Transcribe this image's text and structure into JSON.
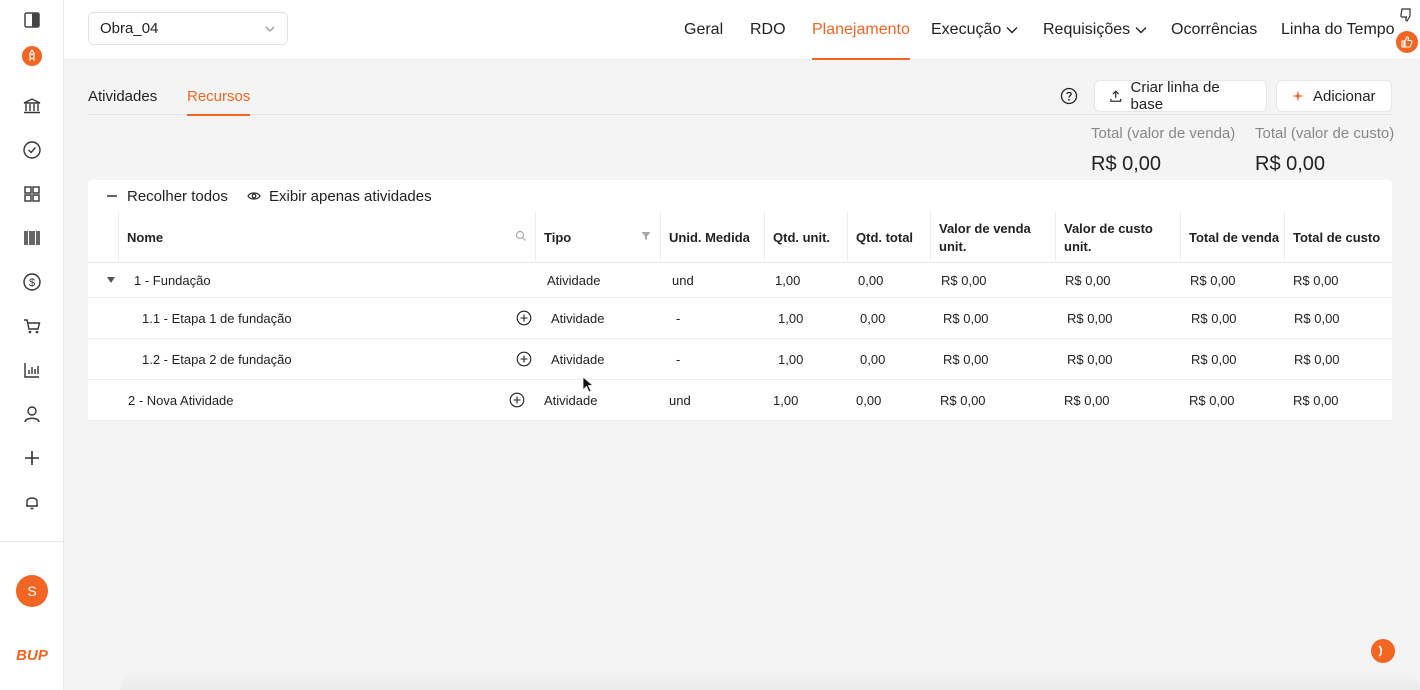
{
  "project": {
    "name": "Obra_04"
  },
  "nav": {
    "items": [
      {
        "label": "Geral"
      },
      {
        "label": "RDO"
      },
      {
        "label": "Planejamento"
      },
      {
        "label": "Execução"
      },
      {
        "label": "Requisições"
      },
      {
        "label": "Ocorrências"
      },
      {
        "label": "Linha do Tempo"
      }
    ]
  },
  "sidebar": {
    "icons": [
      "panel-toggle-icon",
      "rocket-icon",
      "bank-icon",
      "check-circle-icon",
      "grid-icon",
      "barcode-icon",
      "dollar-icon",
      "cart-icon",
      "bar-chart-icon",
      "user-icon",
      "plus-icon",
      "bell-icon"
    ],
    "avatar_initial": "S",
    "logo": "BUP"
  },
  "tabs": [
    {
      "label": "Atividades"
    },
    {
      "label": "Recursos"
    }
  ],
  "actions": {
    "baseline_label": "Criar linha de base",
    "add_label": "Adicionar"
  },
  "totals": {
    "sale_label": "Total (valor de venda)",
    "sale_value": "R$ 0,00",
    "cost_label": "Total (valor de custo)",
    "cost_value": "R$ 0,00"
  },
  "table_tools": {
    "collapse_label": "Recolher todos",
    "show_only_label": "Exibir apenas atividades"
  },
  "table": {
    "columns": [
      "Nome",
      "Tipo",
      "Unid. Medida",
      "Qtd. unit.",
      "Qtd. total",
      "Valor de venda unit.",
      "Valor de custo unit.",
      "Total de venda",
      "Total de custo"
    ],
    "rows": [
      {
        "name": "1 - Fundação",
        "tipo": "Atividade",
        "unid": "und",
        "qtd_unit": "1,00",
        "qtd_total": "0,00",
        "venda_unit": "R$ 0,00",
        "custo_unit": "R$ 0,00",
        "total_venda": "R$ 0,00",
        "total_custo": "R$ 0,00"
      },
      {
        "name": "1.1 - Etapa 1 de fundação",
        "tipo": "Atividade",
        "unid": "-",
        "qtd_unit": "1,00",
        "qtd_total": "0,00",
        "venda_unit": "R$ 0,00",
        "custo_unit": "R$ 0,00",
        "total_venda": "R$ 0,00",
        "total_custo": "R$ 0,00"
      },
      {
        "name": "1.2 - Etapa 2 de fundação",
        "tipo": "Atividade",
        "unid": "-",
        "qtd_unit": "1,00",
        "qtd_total": "0,00",
        "venda_unit": "R$ 0,00",
        "custo_unit": "R$ 0,00",
        "total_venda": "R$ 0,00",
        "total_custo": "R$ 0,00"
      },
      {
        "name": "2 - Nova Atividade",
        "tipo": "Atividade",
        "unid": "und",
        "qtd_unit": "1,00",
        "qtd_total": "0,00",
        "venda_unit": "R$ 0,00",
        "custo_unit": "R$ 0,00",
        "total_venda": "R$ 0,00",
        "total_custo": "R$ 0,00"
      }
    ]
  },
  "colors": {
    "accent": "#f26522"
  }
}
